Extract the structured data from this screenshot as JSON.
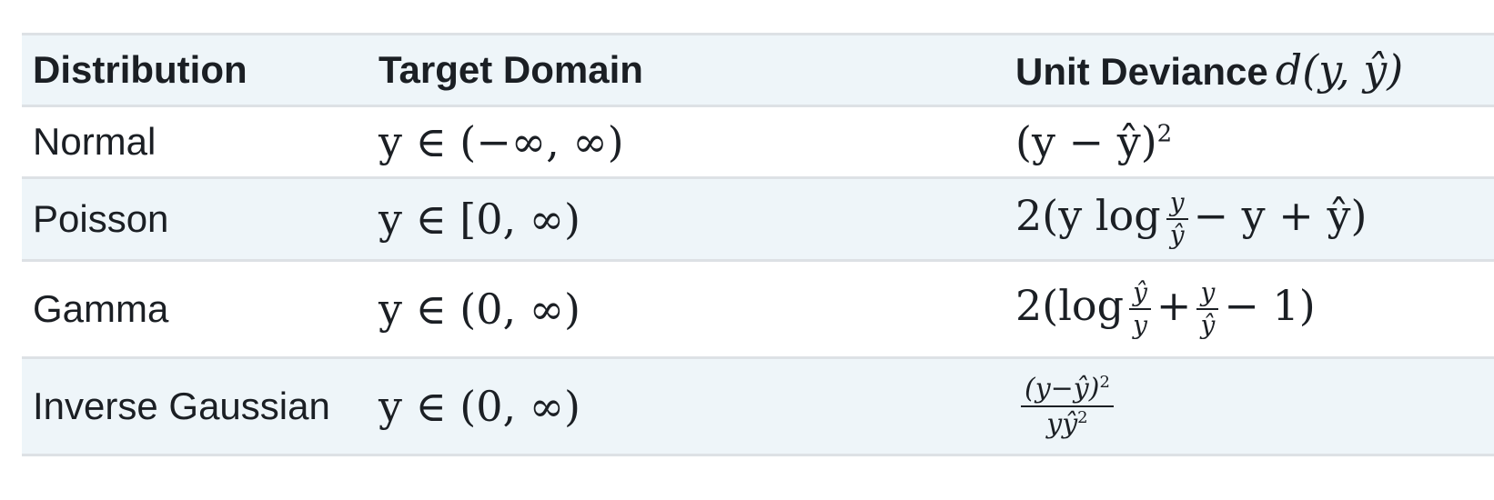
{
  "headers": {
    "distribution": "Distribution",
    "target_domain": "Target Domain",
    "unit_deviance": "Unit Deviance",
    "unit_deviance_math": "d(y, ŷ)"
  },
  "rows": [
    {
      "distribution": "Normal",
      "domain": "y ∈ (−∞, ∞)",
      "deviance": "(y − ŷ)",
      "deviance_exp": "2"
    },
    {
      "distribution": "Poisson",
      "domain": "y ∈ [0, ∞)",
      "deviance_pre": "2(y log",
      "frac_num": "y",
      "frac_den": "ŷ",
      "deviance_post": "− y + ŷ)"
    },
    {
      "distribution": "Gamma",
      "domain": "y ∈ (0, ∞)",
      "deviance_pre": "2(log",
      "frac1_num": "ŷ",
      "frac1_den": "y",
      "deviance_mid": "+",
      "frac2_num": "y",
      "frac2_den": "ŷ",
      "deviance_post": "− 1)"
    },
    {
      "distribution": "Inverse Gaussian",
      "domain": "y ∈ (0, ∞)",
      "frac_num": "(y−ŷ)",
      "frac_num_exp": "2",
      "frac_den": "yŷ",
      "frac_den_exp": "2"
    }
  ]
}
